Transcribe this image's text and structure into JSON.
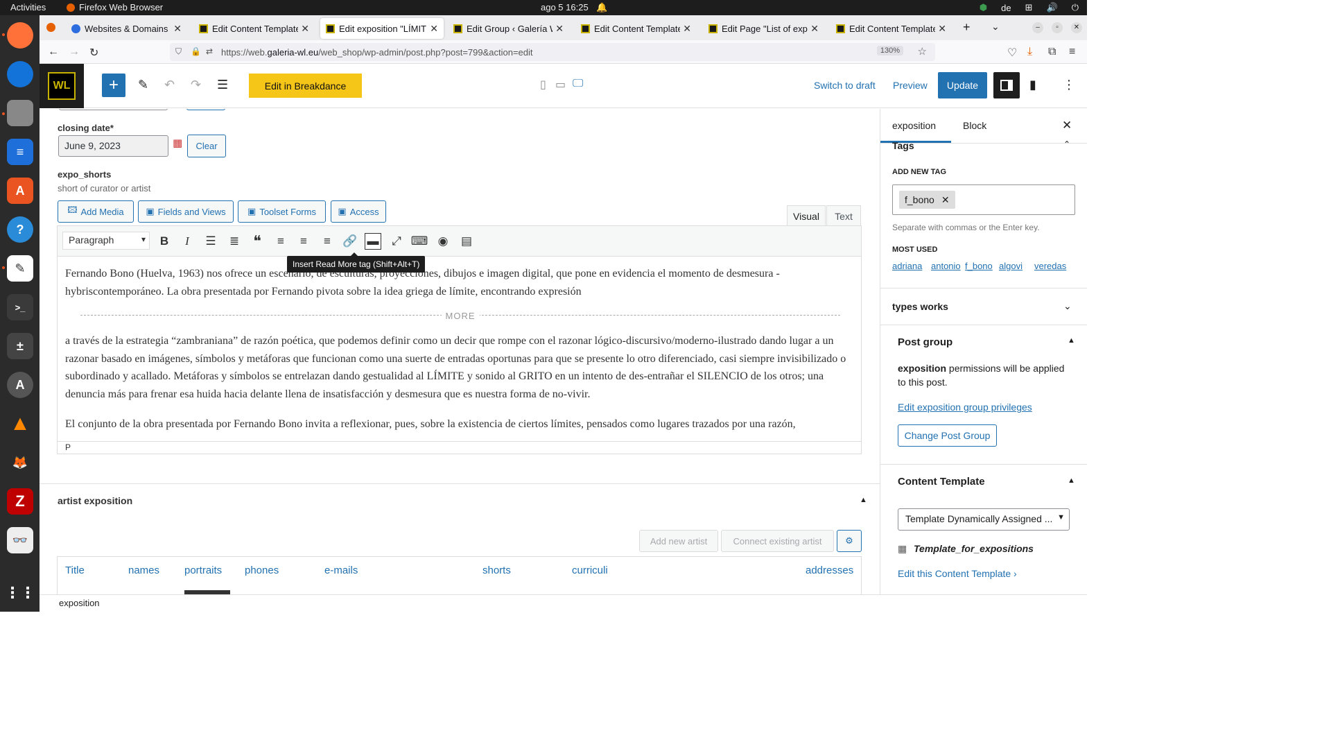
{
  "system": {
    "activities": "Activities",
    "app_name": "Firefox Web Browser",
    "clock": "ago 5  16:25",
    "keyboard": "de"
  },
  "browser": {
    "tabs": [
      {
        "label": "Websites & Domains - Ple",
        "active": false
      },
      {
        "label": "Edit Content Template \"T",
        "active": false
      },
      {
        "label": "Edit exposition \"LÍMITES",
        "active": true
      },
      {
        "label": "Edit Group ‹ Galería Webs",
        "active": false
      },
      {
        "label": "Edit Content Template \"T",
        "active": false
      },
      {
        "label": "Edit Page \"List of exposit",
        "active": false
      },
      {
        "label": "Edit Content Template \"T",
        "active": false
      }
    ],
    "url_prefix": "https://web.",
    "url_domain": "galeria-wl.eu",
    "url_path": "/web_shop/wp-admin/post.php?post=799&action=edit",
    "zoom": "130%"
  },
  "wp_header": {
    "logo_text": "WL",
    "breakdance_label": "Edit in Breakdance",
    "switch_draft_label": "Switch to draft",
    "preview_label": "Preview",
    "update_label": "Update"
  },
  "main": {
    "closing_date_label": "closing date*",
    "closing_date_value": "June 9, 2023",
    "clear_label": "Clear",
    "expo_shorts_label": "expo_shorts",
    "expo_shorts_desc": "short of curator or artist",
    "buttons": {
      "add_media": "Add Media",
      "fields_views": "Fields and Views",
      "toolset_forms": "Toolset Forms",
      "access": "Access"
    },
    "visual_tab": "Visual",
    "text_tab": "Text",
    "format_select": "Paragraph",
    "tooltip": "Insert Read More tag (Shift+Alt+T)",
    "paragraph1": "Fernando Bono (Huelva, 1963) nos ofrece un escenario, de esculturas, proyecciones, dibujos e imagen digital, que pone en evidencia el momento de desmesura -hybriscontemporáneo. La obra presentada por Fernando pivota sobre la idea griega de límite, encontrando expresión",
    "more_label": "MORE",
    "paragraph2": "a través de la estrategia “zambraniana” de razón poética, que podemos definir como un decir que rompe con el razonar lógico-discursivo/moderno-ilustrado dando lugar a un razonar basado en imágenes, símbolos y metáforas que funcionan como una suerte de entradas oportunas para que se presente lo otro diferenciado, casi siempre invisibilizado o subordinado y acallado. Metáforas y símbolos se entrelazan dando gestualidad al LÍMITE y sonido al GRITO en un intento de des-entrañar el SILENCIO de los otros; una denuncia más para frenar esa huida hacia delante llena de insatisfacción y desmesura que es nuestra forma de no-vivir.",
    "paragraph3": "El conjunto de la obra presentada por Fernando Bono invita a reflexionar, pues, sobre la existencia de ciertos límites, pensados como lugares trazados por una razón,",
    "status_path": "P",
    "artist_section_title": "artist exposition",
    "add_new_artist": "Add new artist",
    "connect_existing_artist": "Connect existing artist",
    "table_headers": [
      "Title",
      "names",
      "portraits",
      "phones",
      "e-mails",
      "shorts",
      "curriculi",
      "addresses"
    ]
  },
  "sidebar": {
    "tab_post": "exposition",
    "tab_block": "Block",
    "tags_title": "Tags",
    "add_new_tag": "ADD NEW TAG",
    "tag_chip": "f_bono",
    "tag_help": "Separate with commas or the Enter key.",
    "most_used": "MOST USED",
    "most_used_tags": [
      "adriana",
      "antonio",
      "f_bono",
      "algovi",
      "veredas"
    ],
    "types_works": "types works",
    "post_group_title": "Post group",
    "post_group_bold": "exposition",
    "post_group_text": " permissions will be applied to this post.",
    "edit_privileges": "Edit exposition group privileges",
    "change_group": "Change Post Group",
    "content_template_title": "Content Template",
    "template_select": "Template Dynamically Assigned ...",
    "template_name": "Template_for_expositions",
    "edit_template": "Edit this Content Template ›"
  },
  "footer": {
    "breadcrumb": "exposition"
  },
  "colors": {
    "wp_blue": "#2271b1",
    "breakdance_yellow": "#f5c518"
  }
}
